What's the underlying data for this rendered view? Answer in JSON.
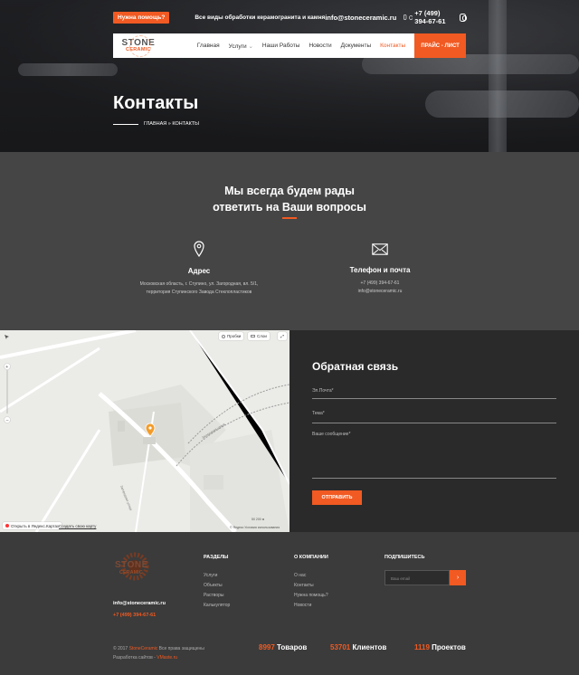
{
  "colors": {
    "accent": "#f15a22",
    "dark": "#2a2a2a",
    "section": "#454545",
    "footer": "#3b3b3b"
  },
  "topbar": {
    "help_label": "Нужна помощь?",
    "tagline": "Все виды обработки керамогранита и камня",
    "email": "info@stoneceramic.ru",
    "phone": "+7 (499) 394-67-61",
    "phone_icons": [
      "phone-icon",
      "whatsapp-icon"
    ],
    "instagram_icon": "instagram-icon"
  },
  "logo": {
    "line1": "STONE",
    "line2": "CERAMIC"
  },
  "nav": {
    "items": [
      "Главная",
      "Услуги",
      "Наши Работы",
      "Новости",
      "Документы",
      "Контакты"
    ],
    "services_caret": "⌄",
    "price_button": "ПРАЙС - ЛИСТ"
  },
  "hero": {
    "title": "Контакты",
    "breadcrumb": "ГЛАВНАЯ » КОНТАКТЫ"
  },
  "intro": {
    "heading_line1": "Мы всегда будем рады",
    "heading_line2": "ответить на Ваши вопросы",
    "address": {
      "title": "Адрес",
      "line1": "Московская область, г. Ступино, ул. Загородная, вл. 5/1,",
      "line2": "территория Ступинского Завода Стеклопластиков",
      "icon": "location-pin-icon"
    },
    "contacts": {
      "title": "Телефон и почта",
      "phone": "+7 (499) 394-67-61",
      "email": "info@stoneceramic.ru",
      "icon": "envelope-icon"
    }
  },
  "map": {
    "traffic_label": "Пробки",
    "layers_label": "Слои",
    "open_link": "Открыть в Яндекс.Картах",
    "create_link": "Создать свою карту",
    "scale": "200 м",
    "scale_prefix": "50",
    "terms": "© Яндекс Условия использования",
    "street1": "Загородная улица",
    "street2": "Загородная улица"
  },
  "form": {
    "title": "Обратная связь",
    "email_placeholder": "Эл.Почта*",
    "subject_placeholder": "Тема*",
    "message_placeholder": "Ваше сообщение*",
    "send_label": "ОТПРАВИТЬ"
  },
  "footer": {
    "sections_title": "РАЗДЕЛЫ",
    "sections": [
      "Услуги",
      "Объекты",
      "Растворы",
      "Калькулятор"
    ],
    "company_title": "О КОМПАНИИ",
    "company": [
      "О нас",
      "Контакты",
      "Нужна помощь?",
      "Новости"
    ],
    "subscribe_title": "ПОДПИШИТЕСЬ",
    "subscribe_placeholder": "Ваш email",
    "subscribe_arrow": "›",
    "email": "info@stoneceramic.ru",
    "phone": "+7 (499) 394-67-61",
    "copy_prefix": "© 2017",
    "copy_brand": "StoneCeramic",
    "copy_rights": "Все права защищены",
    "dev_prefix": "Разработка сайтов -",
    "dev_link": "VMaste.ru",
    "stats": [
      {
        "num": "8997",
        "label": "Товаров"
      },
      {
        "num": "53701",
        "label": "Клиентов"
      },
      {
        "num": "1119",
        "label": "Проектов"
      }
    ]
  }
}
